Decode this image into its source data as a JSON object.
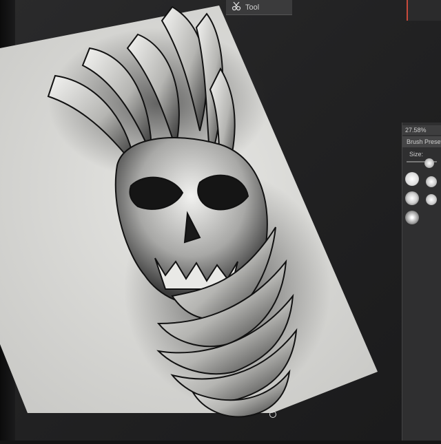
{
  "toolbar": {
    "label": "Tool"
  },
  "panel": {
    "zoom": "27.58%",
    "brush_presets_label": "Brush Presets",
    "size_label": "Size:"
  },
  "icons": {
    "toolbar_icon": "scissors-icon",
    "cursor": "brush-cursor-icon"
  },
  "colors": {
    "canvas_paper": "#d9d9d6",
    "workspace": "#252526",
    "panel": "#2f2f30",
    "accent": "#c94a3b"
  }
}
